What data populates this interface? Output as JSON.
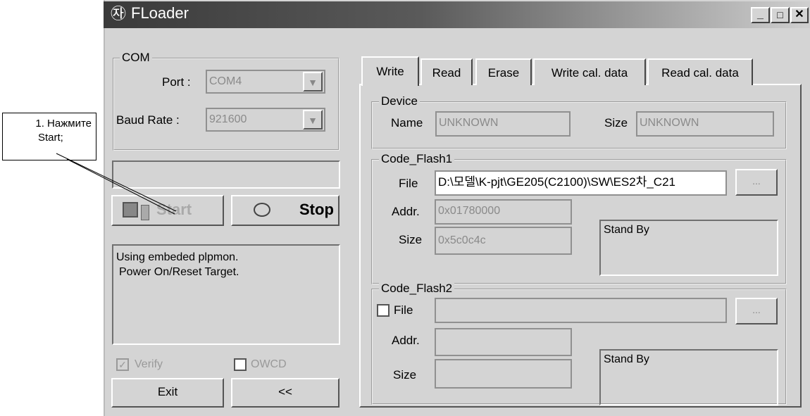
{
  "window": {
    "title": "FLoader"
  },
  "titlebar": {
    "minimize": "_",
    "maximize": "□",
    "close": "✕"
  },
  "com": {
    "legend": "COM",
    "port_label": "Port :",
    "port_value": "COM4",
    "baud_label": "Baud Rate :",
    "baud_value": "921600"
  },
  "buttons": {
    "start": "Start",
    "stop": "Stop",
    "exit": "Exit",
    "back": "<<"
  },
  "log": {
    "lines": [
      "Using embeded plpmon.",
      "Power On/Reset Target."
    ]
  },
  "options": {
    "verify": "Verify",
    "owcd": "OWCD"
  },
  "tabs": [
    "Write",
    "Read",
    "Erase",
    "Write cal. data",
    "Read cal. data"
  ],
  "device": {
    "legend": "Device",
    "name_label": "Name",
    "name_value": "UNKNOWN",
    "size_label": "Size",
    "size_value": "UNKNOWN"
  },
  "flash1": {
    "legend": "Code_Flash1",
    "file_label": "File",
    "file_value": "D:\\모델\\K-pjt\\GE205(C2100)\\SW\\ES2차_C21",
    "browse": "...",
    "addr_label": "Addr.",
    "addr_value": "0x01780000",
    "size_label": "Size",
    "size_value": "0x5c0c4c",
    "status": "Stand By"
  },
  "flash2": {
    "legend": "Code_Flash2",
    "file_label": "File",
    "file_value": "",
    "browse": "...",
    "addr_label": "Addr.",
    "addr_value": "",
    "size_label": "Size",
    "size_value": "",
    "status": "Stand By"
  },
  "annotation": {
    "text_line1": "1. Нажмите",
    "text_line2": "Start;"
  }
}
